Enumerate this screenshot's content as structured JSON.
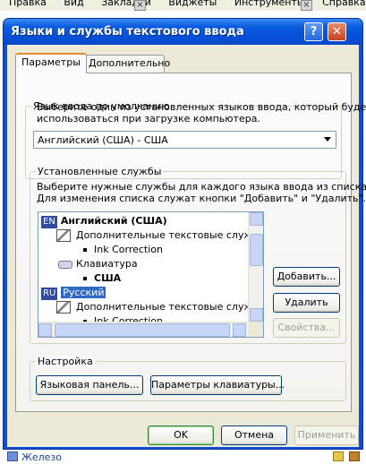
{
  "background": {
    "menubar": [
      "Правка",
      "Вид",
      "Закладки",
      "Виджеты",
      "Инструменты",
      "Справка"
    ],
    "bottom_text": "Железо"
  },
  "dialog": {
    "title": "Языки и службы текстового ввода",
    "help_glyph": "?",
    "close_glyph": "✕",
    "tabs": [
      {
        "label": "Параметры",
        "active": true
      },
      {
        "label": "Дополнительно",
        "active": false
      }
    ],
    "default_lang": {
      "legend": "Язык ввода по умолчанию",
      "desc_line1": "Выберите один из установленных языков ввода, который будет",
      "desc_line2": "использоваться при загрузке компьютера.",
      "selected": "Английский (США) - США"
    },
    "services": {
      "legend": "Установленные службы",
      "desc_line1": "Выберите нужные службы для каждого языка ввода из списка.",
      "desc_line2": "Для изменения списка служат кнопки \"Добавить\" и \"Удалить\".",
      "tree": [
        {
          "badge": "EN",
          "label": "Английский (США)"
        },
        {
          "label": "Дополнительные текстовые службы"
        },
        {
          "label": "Ink Correction"
        },
        {
          "label": "Клавиатура"
        },
        {
          "label": "США"
        },
        {
          "badge": "RU",
          "label": "Русский"
        },
        {
          "label": "Дополнительные текстовые службы"
        },
        {
          "label": "Ink Correction"
        }
      ],
      "buttons": {
        "add": "Добавить...",
        "remove": "Удалить",
        "properties": "Свойства..."
      }
    },
    "settings": {
      "legend": "Настройка",
      "language_bar": "Языковая панель...",
      "key_settings": "Параметры клавиатуры..."
    },
    "footer": {
      "ok": "OK",
      "cancel": "Отмена",
      "apply": "Применить"
    }
  },
  "colors": {
    "titlebar": "#0550d8",
    "selection": "#316ac5",
    "face": "#ece9d8"
  }
}
